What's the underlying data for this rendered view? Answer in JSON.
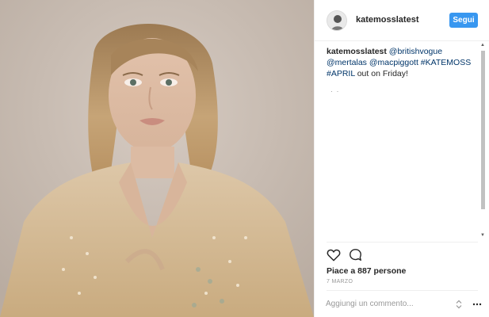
{
  "post": {
    "username": "katemosslatest",
    "follow_label": "Segui",
    "caption": {
      "user": "katemosslatest",
      "mentions": [
        "@britishvogue",
        "@mertalas",
        "@macpiggott",
        "#KATEMOSS",
        "#APRIL"
      ],
      "text_tail": "out on Friday!",
      "more_dots": "· ·"
    },
    "likes_text": "Piace a 887 persone",
    "date": "7 MARZO",
    "comment_placeholder": "Aggiungi un commento..."
  },
  "icons": {
    "like": "heart-icon",
    "comment": "comment-bubble-icon",
    "expand": "expand-icon",
    "more": "more-options-icon"
  },
  "colors": {
    "accent": "#3897f0",
    "text": "#262626",
    "muted": "#999999",
    "link": "#003569"
  }
}
